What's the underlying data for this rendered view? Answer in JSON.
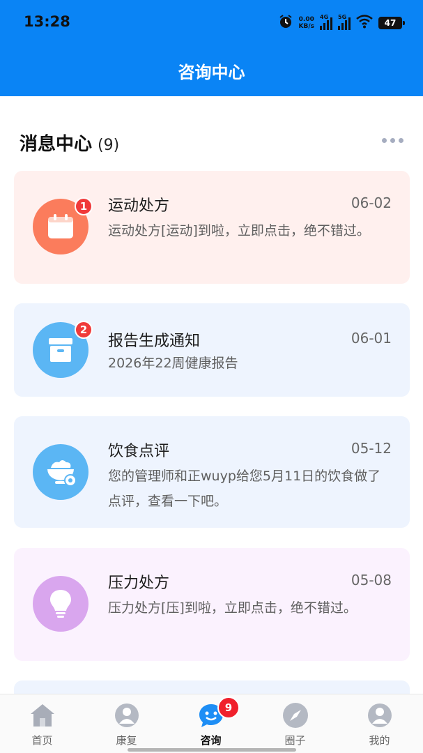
{
  "status_bar": {
    "time": "13:28",
    "speed_value": "0.00",
    "speed_unit": "KB/s",
    "signal1_label": "4G",
    "signal2_label": "5G",
    "battery": "47"
  },
  "header": {
    "title": "咨询中心"
  },
  "section": {
    "title": "消息中心",
    "count": "(9)"
  },
  "messages": [
    {
      "title": "运动处方",
      "date": "06-02",
      "desc": "运动处方[运动]到啦，立即点击，绝不错过。",
      "badge": "1",
      "icon": "calendar-icon",
      "bg": "#fff0ee",
      "icon_color": "#fb7c5c"
    },
    {
      "title": "报告生成通知",
      "date": "06-01",
      "desc": "2026年22周健康报告",
      "badge": "2",
      "icon": "archive-box-icon",
      "bg": "#eef4fe",
      "icon_color": "#5bb6f4"
    },
    {
      "title": "饮食点评",
      "date": "05-12",
      "desc": "您的管理师和正wuyp给您5月11日的饮食做了点评，查看一下吧。",
      "badge": "",
      "icon": "rice-bowl-icon",
      "bg": "#eef4fe",
      "icon_color": "#5bb6f4"
    },
    {
      "title": "压力处方",
      "date": "05-08",
      "desc": "压力处方[压]到啦，立即点击，绝不错过。",
      "badge": "",
      "icon": "lightbulb-icon",
      "bg": "#fbf2fe",
      "icon_color": "#d9a6ee"
    }
  ],
  "nav": {
    "items": [
      {
        "label": "首页",
        "icon": "home-icon"
      },
      {
        "label": "康复",
        "icon": "person-icon"
      },
      {
        "label": "咨询",
        "icon": "chat-bubble-icon",
        "badge": "9"
      },
      {
        "label": "圈子",
        "icon": "compass-icon"
      },
      {
        "label": "我的",
        "icon": "profile-icon"
      }
    ],
    "active": "咨询"
  },
  "colors": {
    "brand": "#0a84f5",
    "badge_red": "#f03a3a"
  }
}
